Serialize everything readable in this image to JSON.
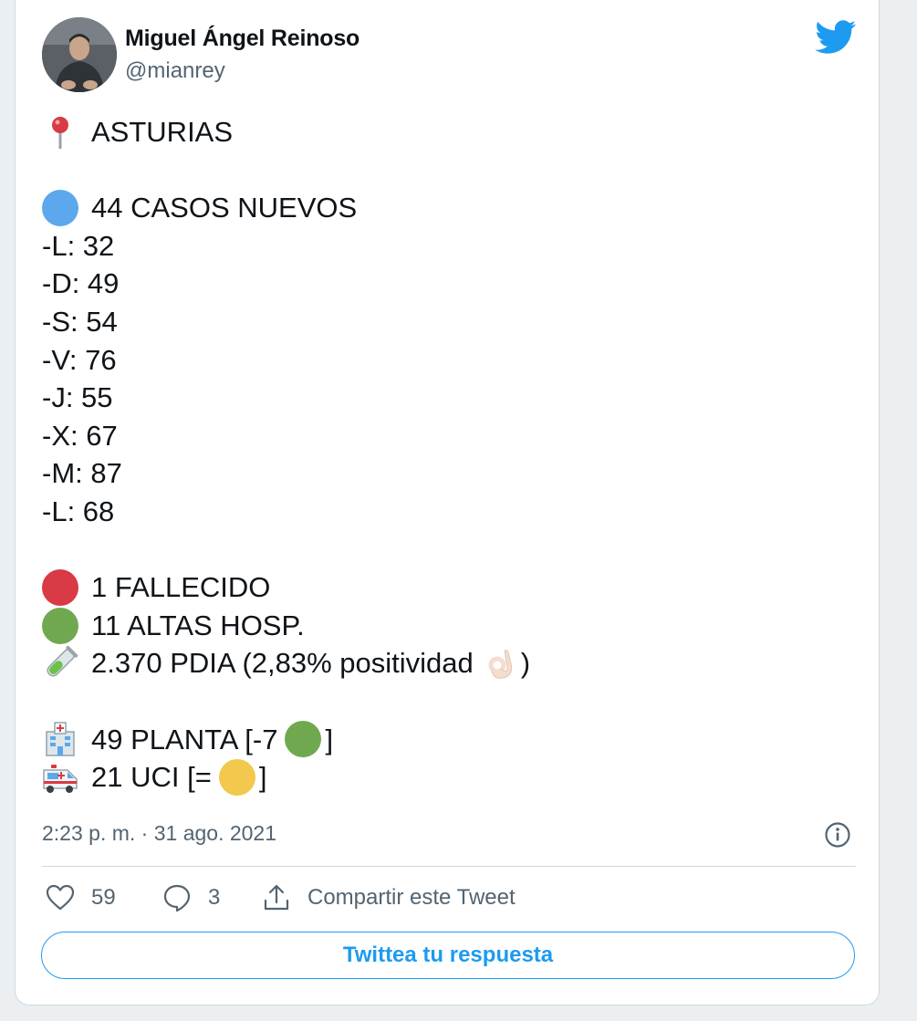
{
  "author": {
    "name": "Miguel Ángel Reinoso",
    "handle": "@mianrey"
  },
  "tweet": {
    "location": "ASTURIAS",
    "new_cases": "44 CASOS NUEVOS",
    "daily_lines": [
      "-L: 32",
      "-D: 49",
      "-S: 54",
      "-V: 76",
      "-J: 55",
      "-X: 67",
      "-M: 87",
      "-L: 68"
    ],
    "deaths": "1 FALLECIDO",
    "discharges": "11 ALTAS HOSP.",
    "tests": "2.370 PDIA (2,83% positividad",
    "tests_close": ")",
    "ward": "49 PLANTA [-7",
    "ward_close": "]",
    "icu": "21 UCI [=",
    "icu_close": "]",
    "timestamp": "2:23 p. m. · 31 ago. 2021"
  },
  "actions": {
    "likes": "59",
    "replies": "3",
    "share_label": "Compartir este Tweet"
  },
  "reply_button_label": "Twittea tu respuesta",
  "icons": {
    "location": "round-pushpin-icon",
    "new_cases": "blue-circle-icon",
    "deaths": "red-circle-icon",
    "discharges": "green-circle-icon",
    "tests": "test-tube-icon",
    "tests_reaction": "ok-hand-icon",
    "ward": "hospital-icon",
    "ward_trend": "green-circle-icon",
    "icu": "ambulance-icon",
    "icu_trend": "yellow-circle-icon",
    "brand": "twitter-bird-icon",
    "info": "info-icon",
    "like": "heart-icon",
    "reply": "speech-bubble-icon",
    "share": "share-icon"
  },
  "colors": {
    "accent": "#1d9bf0",
    "blue_circle": "#5ba8ec",
    "red_circle": "#d83a46",
    "green_circle": "#70a84f",
    "yellow_circle": "#f2c94c",
    "muted_text": "#536471"
  }
}
